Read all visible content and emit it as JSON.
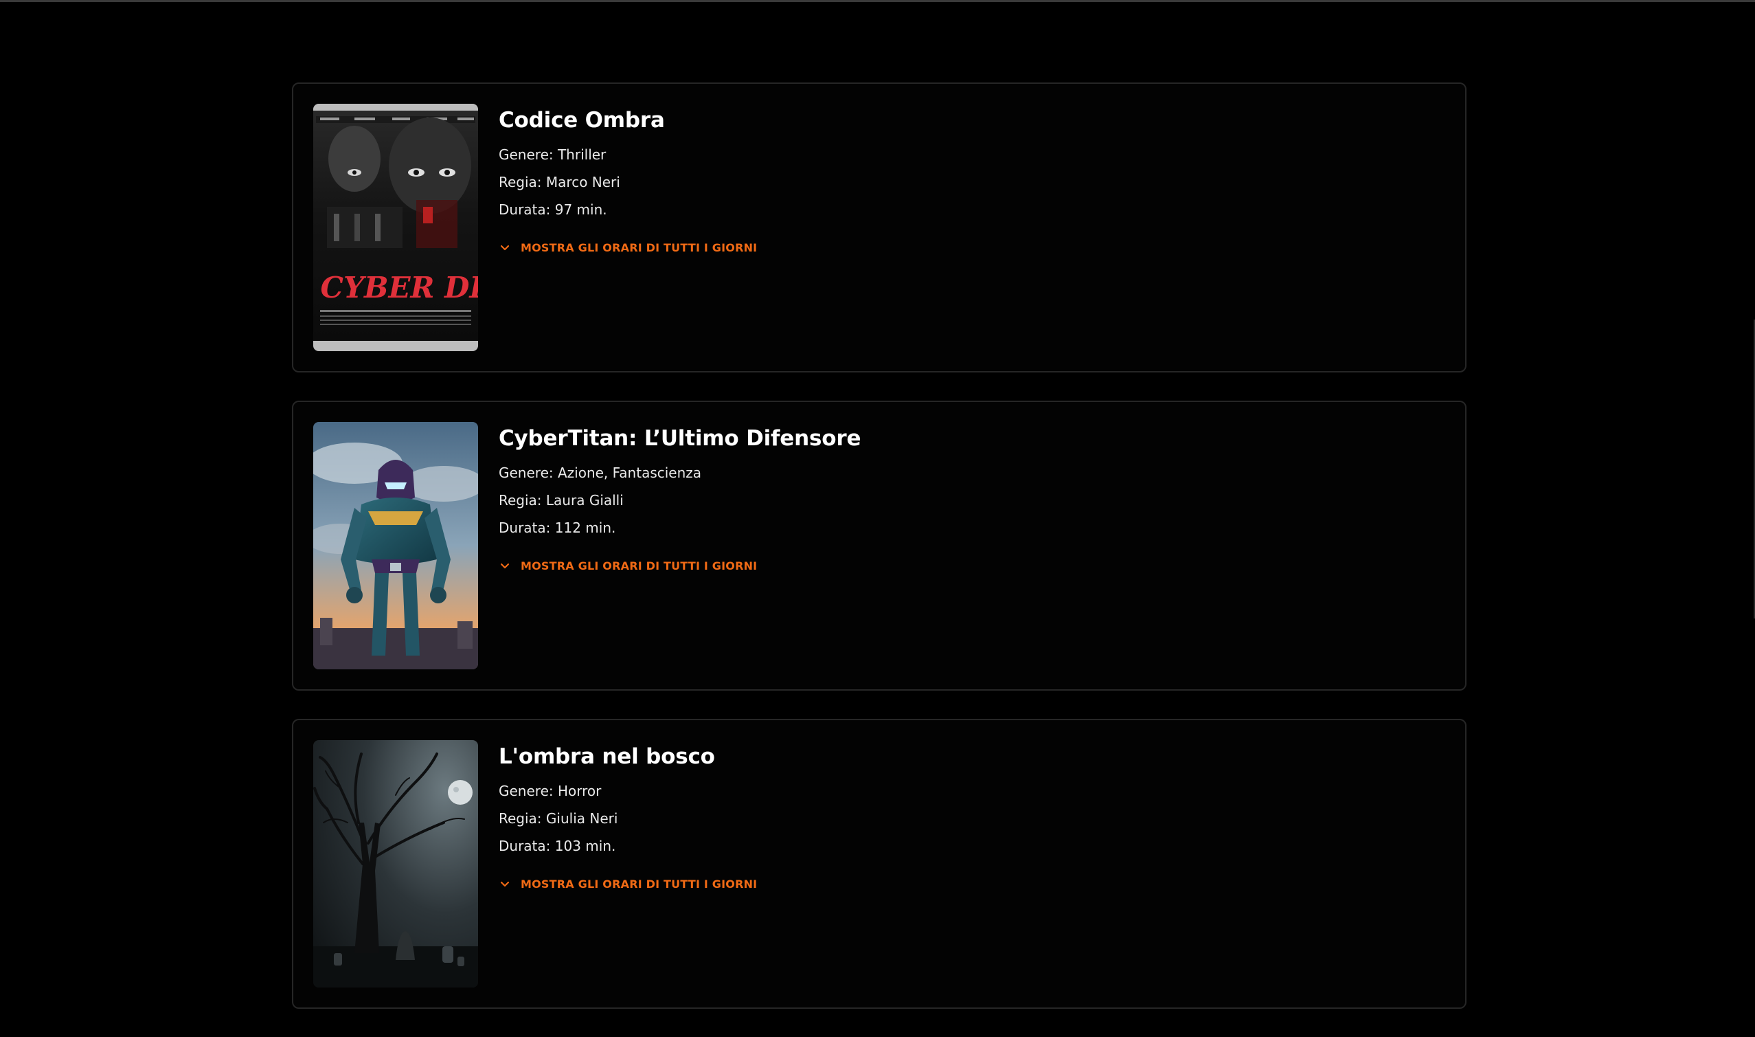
{
  "films": [
    {
      "title": "Codice Ombra",
      "genre": "Genere: Thriller",
      "director": "Regia: Marco Neri",
      "duration": "Durata: 97 min.",
      "toggle_label": "MOSTRA GLI ORARI DI TUTTI I GIORNI",
      "poster_text": "THE CYBER DLINE"
    },
    {
      "title": "CyberTitan: L’Ultimo Difensore",
      "genre": "Genere: Azione, Fantascienza",
      "director": "Regia: Laura Gialli",
      "duration": "Durata: 112 min.",
      "toggle_label": "MOSTRA GLI ORARI DI TUTTI I GIORNI"
    },
    {
      "title": "L'ombra nel bosco",
      "genre": "Genere: Horror",
      "director": "Regia: Giulia Neri",
      "duration": "Durata: 103 min.",
      "toggle_label": "MOSTRA GLI ORARI DI TUTTI I GIORNI"
    }
  ],
  "colors": {
    "background": "#000000",
    "card_border": "#262626",
    "accent": "#f06a15",
    "text": "#ffffff"
  },
  "icons": {
    "toggle": "chevron-down-icon"
  }
}
